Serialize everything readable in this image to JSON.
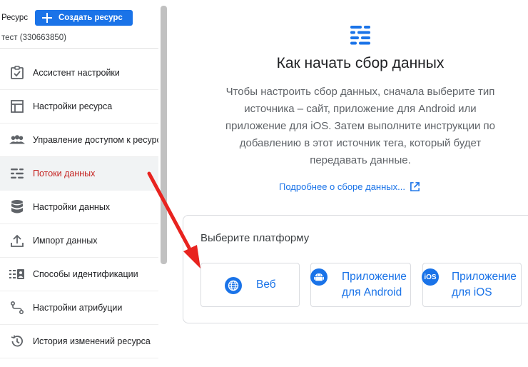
{
  "sidebar": {
    "property_label": "Ресурс",
    "create_button": "Создать ресурс",
    "property_id": "тест (330663850)",
    "items": [
      {
        "label": "Ассистент настройки",
        "icon": "checklist-icon"
      },
      {
        "label": "Настройки ресурса",
        "icon": "layout-icon"
      },
      {
        "label": "Управление доступом к ресурсу",
        "icon": "people-icon"
      },
      {
        "label": "Потоки данных",
        "icon": "streams-icon",
        "active": true
      },
      {
        "label": "Настройки данных",
        "icon": "database-icon"
      },
      {
        "label": "Импорт данных",
        "icon": "upload-icon"
      },
      {
        "label": "Способы идентификации",
        "icon": "identity-icon"
      },
      {
        "label": "Настройки атрибуции",
        "icon": "attribution-icon"
      },
      {
        "label": "История изменений ресурса",
        "icon": "history-icon"
      }
    ]
  },
  "main": {
    "title": "Как начать сбор данных",
    "description": "Чтобы настроить сбор данных, сначала выберите тип источника – сайт, приложение для Android или приложение для iOS. Затем выполните инструкции по добавлению в этот источник тега, который будет передавать данные.",
    "more_link": "Подробнее о сборе данных...",
    "platform": {
      "title": "Выберите платформу",
      "web": "Веб",
      "android_line1": "Приложение",
      "android_line2": "для Android",
      "ios_line1": "Приложение",
      "ios_line2": "для iOS"
    }
  },
  "colors": {
    "accent": "#1a73e8",
    "active_nav_text": "#c5221f",
    "arrow": "#e8231f"
  }
}
